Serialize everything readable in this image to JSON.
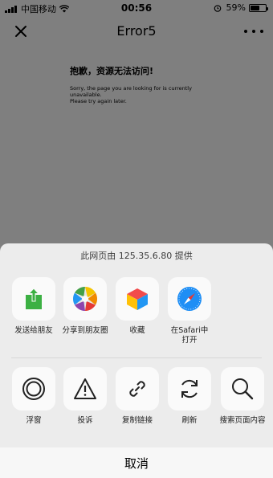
{
  "status_bar": {
    "carrier": "中国移动",
    "time": "00:56",
    "battery_percent": "59%",
    "battery_level": 0.59,
    "icons": [
      "signal-icon",
      "wifi-icon",
      "alarm-icon",
      "battery-icon"
    ]
  },
  "navbar": {
    "title": "Error5",
    "close_icon": "close-icon",
    "more_icon": "more-icon"
  },
  "page": {
    "error_title": "抱歉，资源无法访问!",
    "error_message_line1": "Sorry, the page you are looking for is currently unavailable.",
    "error_message_line2": "Please try again later."
  },
  "share_sheet": {
    "source_text": "此网页由 125.35.6.80 提供",
    "row1": [
      {
        "label": "发送给朋友",
        "icon": "share-to-friend-icon"
      },
      {
        "label": "分享到朋友圈",
        "icon": "moments-icon"
      },
      {
        "label": "收藏",
        "icon": "favorites-icon"
      },
      {
        "label": "在Safari中打开",
        "icon": "safari-icon"
      }
    ],
    "row2": [
      {
        "label": "浮窗",
        "icon": "float-window-icon"
      },
      {
        "label": "投诉",
        "icon": "warning-icon"
      },
      {
        "label": "复制链接",
        "icon": "link-icon"
      },
      {
        "label": "刷新",
        "icon": "refresh-icon"
      },
      {
        "label": "搜索页面内容",
        "icon": "search-icon"
      }
    ],
    "cancel_label": "取消"
  },
  "colors": {
    "overlay": "#7f7f7f",
    "sheet_bg": "#ececec",
    "tile_bg": "#fafafa",
    "share_green": "#3cb043",
    "safari_blue": "#1e8ef5"
  }
}
